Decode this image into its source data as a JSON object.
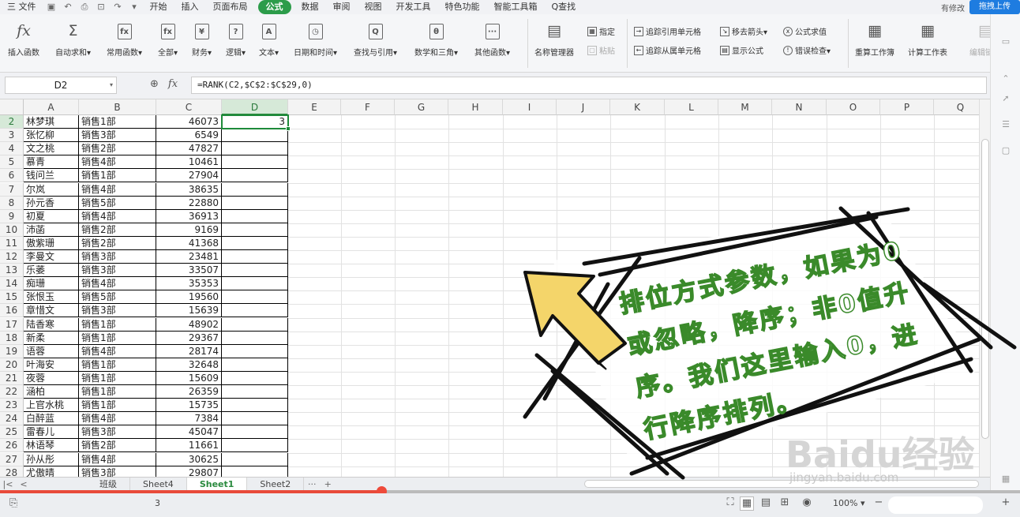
{
  "menubar": {
    "file_menu": "三 文件",
    "tabs": [
      "开始",
      "插入",
      "页面布局",
      "公式",
      "数据",
      "审阅",
      "视图",
      "开发工具",
      "特色功能",
      "智能工具箱"
    ],
    "active_tab": "公式",
    "search": "Q查找",
    "status_right": "有修改",
    "upload_button": "拖拽上传"
  },
  "ribbon": {
    "big_buttons": [
      {
        "icon": "fx",
        "label": "插入函数"
      },
      {
        "icon": "Σ",
        "label": "自动求和▾"
      },
      {
        "icon": "fx",
        "label": "常用函数▾"
      },
      {
        "icon": "fx",
        "label": "全部▾"
      },
      {
        "icon": "¥",
        "label": "财务▾"
      },
      {
        "icon": "?",
        "label": "逻辑▾"
      },
      {
        "icon": "A",
        "label": "文本▾"
      },
      {
        "icon": "◷",
        "label": "日期和时间▾"
      },
      {
        "icon": "Q",
        "label": "查找与引用▾"
      },
      {
        "icon": "θ",
        "label": "数学和三角▾"
      },
      {
        "icon": "···",
        "label": "其他函数▾"
      },
      {
        "icon": "▤",
        "label": "名称管理器"
      }
    ],
    "small_buttons": [
      {
        "label": "指定"
      },
      {
        "label": "粘贴"
      },
      {
        "label": "追踪引用单元格"
      },
      {
        "label": "追踪从属单元格"
      },
      {
        "label": "移去箭头▾"
      },
      {
        "label": "显示公式"
      },
      {
        "label": "公式求值"
      },
      {
        "label": "错误检查▾"
      }
    ],
    "calc_buttons": [
      {
        "label": "重算工作簿"
      },
      {
        "label": "计算工作表"
      },
      {
        "label": "编辑链接"
      }
    ]
  },
  "formula_bar": {
    "name_box": "D2",
    "fx": "fx",
    "formula": "=RANK(C2,$C$2:$C$29,0)"
  },
  "columns": [
    "A",
    "B",
    "C",
    "D",
    "E",
    "F",
    "G",
    "H",
    "I",
    "J",
    "K",
    "L",
    "M",
    "N",
    "O",
    "P",
    "Q"
  ],
  "selected_column": "D",
  "rows": [
    {
      "n": "2",
      "name": "林梦琪",
      "dept": "销售1部",
      "value": "46073",
      "rank": "3"
    },
    {
      "n": "3",
      "name": "张忆柳",
      "dept": "销售3部",
      "value": "6549",
      "rank": ""
    },
    {
      "n": "4",
      "name": "文之桃",
      "dept": "销售2部",
      "value": "47827",
      "rank": ""
    },
    {
      "n": "5",
      "name": "慕青",
      "dept": "销售4部",
      "value": "10461",
      "rank": ""
    },
    {
      "n": "6",
      "name": "钱问兰",
      "dept": "销售1部",
      "value": "27904",
      "rank": ""
    },
    {
      "n": "7",
      "name": "尔岚",
      "dept": "销售4部",
      "value": "38635",
      "rank": ""
    },
    {
      "n": "8",
      "name": "孙元香",
      "dept": "销售5部",
      "value": "22880",
      "rank": ""
    },
    {
      "n": "9",
      "name": "初夏",
      "dept": "销售4部",
      "value": "36913",
      "rank": ""
    },
    {
      "n": "10",
      "name": "沛菡",
      "dept": "销售2部",
      "value": "9169",
      "rank": ""
    },
    {
      "n": "11",
      "name": "傲紫珊",
      "dept": "销售2部",
      "value": "41368",
      "rank": ""
    },
    {
      "n": "12",
      "name": "李曼文",
      "dept": "销售3部",
      "value": "23481",
      "rank": ""
    },
    {
      "n": "13",
      "name": "乐萎",
      "dept": "销售3部",
      "value": "33507",
      "rank": ""
    },
    {
      "n": "14",
      "name": "痴珊",
      "dept": "销售4部",
      "value": "35353",
      "rank": ""
    },
    {
      "n": "15",
      "name": "张恨玉",
      "dept": "销售5部",
      "value": "19560",
      "rank": ""
    },
    {
      "n": "16",
      "name": "章惜文",
      "dept": "销售3部",
      "value": "15639",
      "rank": ""
    },
    {
      "n": "17",
      "name": "陆香寒",
      "dept": "销售1部",
      "value": "48902",
      "rank": ""
    },
    {
      "n": "18",
      "name": "新柔",
      "dept": "销售1部",
      "value": "29367",
      "rank": ""
    },
    {
      "n": "19",
      "name": "语蓉",
      "dept": "销售4部",
      "value": "28174",
      "rank": ""
    },
    {
      "n": "20",
      "name": "叶海安",
      "dept": "销售1部",
      "value": "32648",
      "rank": ""
    },
    {
      "n": "21",
      "name": "夜蓉",
      "dept": "销售1部",
      "value": "15609",
      "rank": ""
    },
    {
      "n": "22",
      "name": "涵柏",
      "dept": "销售1部",
      "value": "26359",
      "rank": ""
    },
    {
      "n": "23",
      "name": "上官水桃",
      "dept": "销售1部",
      "value": "15735",
      "rank": ""
    },
    {
      "n": "24",
      "name": "白醉蓝",
      "dept": "销售4部",
      "value": "7384",
      "rank": ""
    },
    {
      "n": "25",
      "name": "雷春儿",
      "dept": "销售3部",
      "value": "45047",
      "rank": ""
    },
    {
      "n": "26",
      "name": "林语琴",
      "dept": "销售2部",
      "value": "11661",
      "rank": ""
    },
    {
      "n": "27",
      "name": "孙从彤",
      "dept": "销售4部",
      "value": "30625",
      "rank": ""
    },
    {
      "n": "28",
      "name": "尤傲晴",
      "dept": "销售3部",
      "value": "29807",
      "rank": ""
    }
  ],
  "sheet_tabs": [
    "班级",
    "Sheet4",
    "Sheet1",
    "Sheet2"
  ],
  "active_sheet": "Sheet1",
  "tab_more": "···",
  "tab_add": "+",
  "status": {
    "value": "3",
    "zoom": "100% ▾",
    "zoom_minus": "−",
    "zoom_plus": "+"
  },
  "video_progress": 0.374,
  "overlay": {
    "caption": "排位方式参数，如果为0或忽略，降序；非0值升序。我们这里输入0，进行降序排列。",
    "watermark_logo": "Baidu经验",
    "watermark_url": "jingyan.baidu.com"
  },
  "colors": {
    "accent": "#2c9c4a",
    "caption_outline": "#3a8a2a",
    "arrow_fill": "#f4d56a",
    "progress": "#e84a3a"
  }
}
